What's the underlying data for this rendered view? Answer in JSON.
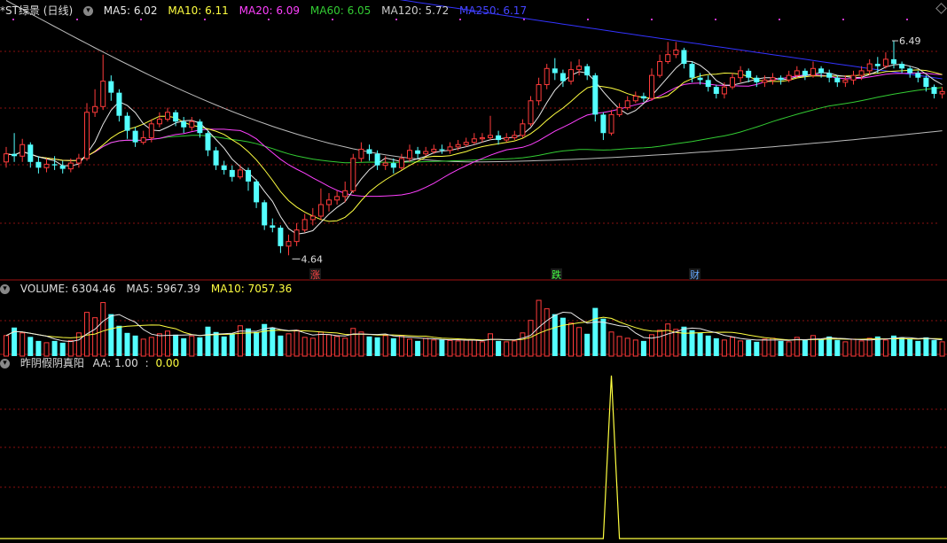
{
  "colors": {
    "up": "#ff3b3b",
    "down": "#54ffff",
    "ma5": "#e8e8e8",
    "ma10": "#ffff40",
    "ma20": "#ff40ff",
    "ma60": "#33cc33",
    "ma120": "#bbbbbb",
    "ma250": "#3333ff",
    "aa": "#ffff40",
    "grid": "#8a1010"
  },
  "icons": [
    "chevron-down-icon",
    "diamond-icon"
  ],
  "price_panel": {
    "title": "*ST绿景 (日线)",
    "ma5": "MA5: 6.02",
    "ma10": "MA10: 6.11",
    "ma20": "MA20: 6.09",
    "ma60": "MA60: 6.05",
    "ma120": "MA120: 5.72",
    "ma250": "MA250: 6.17",
    "high_label": "6.49",
    "low_label": "4.64",
    "markers": [
      "涨",
      "跌",
      "财"
    ]
  },
  "volume_panel": {
    "volume": "VOLUME: 6304.46",
    "ma5": "MA5: 5967.39",
    "ma10": "MA10: 7057.36"
  },
  "indicator_panel": {
    "name": "昨阴假阴真阳",
    "aa": "AA: 1.00",
    "sep": ":",
    "val": "0.00"
  },
  "chart_data": {
    "type": "candlestick",
    "title": "*ST绿景 (日线)",
    "price_extremes": {
      "high": 6.49,
      "low": 4.64
    },
    "ma_latest": {
      "MA5": 6.02,
      "MA10": 6.11,
      "MA20": 6.09,
      "MA60": 6.05,
      "MA120": 5.72,
      "MA250": 6.17
    },
    "candles": [
      [
        5.45,
        5.52,
        5.58,
        5.4
      ],
      [
        5.52,
        5.5,
        5.7,
        5.45
      ],
      [
        5.5,
        5.6,
        5.65,
        5.45
      ],
      [
        5.6,
        5.45,
        5.62,
        5.4
      ],
      [
        5.45,
        5.4,
        5.5,
        5.35
      ],
      [
        5.4,
        5.43,
        5.48,
        5.36
      ],
      [
        5.43,
        5.42,
        5.5,
        5.38
      ],
      [
        5.42,
        5.39,
        5.46,
        5.35
      ],
      [
        5.39,
        5.44,
        5.48,
        5.36
      ],
      [
        5.44,
        5.48,
        5.52,
        5.4
      ],
      [
        5.48,
        5.88,
        5.96,
        5.46
      ],
      [
        5.88,
        5.93,
        6.08,
        5.84
      ],
      [
        5.93,
        6.15,
        6.38,
        5.9
      ],
      [
        6.15,
        6.05,
        6.2,
        5.98
      ],
      [
        6.05,
        5.85,
        6.08,
        5.8
      ],
      [
        5.85,
        5.72,
        5.88,
        5.65
      ],
      [
        5.72,
        5.62,
        5.75,
        5.58
      ],
      [
        5.62,
        5.66,
        5.72,
        5.6
      ],
      [
        5.66,
        5.78,
        5.82,
        5.62
      ],
      [
        5.78,
        5.82,
        5.88,
        5.75
      ],
      [
        5.82,
        5.88,
        5.92,
        5.8
      ],
      [
        5.88,
        5.8,
        5.9,
        5.76
      ],
      [
        5.8,
        5.75,
        5.84,
        5.7
      ],
      [
        5.75,
        5.8,
        5.84,
        5.72
      ],
      [
        5.8,
        5.7,
        5.82,
        5.66
      ],
      [
        5.7,
        5.55,
        5.72,
        5.5
      ],
      [
        5.55,
        5.42,
        5.58,
        5.38
      ],
      [
        5.42,
        5.38,
        5.46,
        5.34
      ],
      [
        5.38,
        5.32,
        5.42,
        5.28
      ],
      [
        5.32,
        5.38,
        5.42,
        5.3
      ],
      [
        5.38,
        5.28,
        5.4,
        5.2
      ],
      [
        5.28,
        5.1,
        5.3,
        5.05
      ],
      [
        5.1,
        4.9,
        5.12,
        4.86
      ],
      [
        4.9,
        4.88,
        4.96,
        4.84
      ],
      [
        4.88,
        4.72,
        4.9,
        4.66
      ],
      [
        4.72,
        4.76,
        4.82,
        4.64
      ],
      [
        4.76,
        4.86,
        4.92,
        4.72
      ],
      [
        4.86,
        4.95,
        5.0,
        4.84
      ],
      [
        4.95,
        4.98,
        5.05,
        4.9
      ],
      [
        4.98,
        5.08,
        5.22,
        4.95
      ],
      [
        5.08,
        5.12,
        5.18,
        5.02
      ],
      [
        5.12,
        5.15,
        5.2,
        5.08
      ],
      [
        5.15,
        5.2,
        5.28,
        5.1
      ],
      [
        5.2,
        5.48,
        5.52,
        5.18
      ],
      [
        5.48,
        5.56,
        5.62,
        5.45
      ],
      [
        5.56,
        5.52,
        5.6,
        5.46
      ],
      [
        5.52,
        5.42,
        5.55,
        5.38
      ],
      [
        5.42,
        5.44,
        5.5,
        5.38
      ],
      [
        5.44,
        5.4,
        5.48,
        5.35
      ],
      [
        5.4,
        5.48,
        5.52,
        5.38
      ],
      [
        5.48,
        5.55,
        5.6,
        5.45
      ],
      [
        5.55,
        5.52,
        5.58,
        5.48
      ],
      [
        5.52,
        5.54,
        5.58,
        5.5
      ],
      [
        5.54,
        5.56,
        5.6,
        5.52
      ],
      [
        5.56,
        5.55,
        5.6,
        5.52
      ],
      [
        5.55,
        5.58,
        5.62,
        5.52
      ],
      [
        5.58,
        5.6,
        5.64,
        5.55
      ],
      [
        5.6,
        5.62,
        5.66,
        5.58
      ],
      [
        5.62,
        5.65,
        5.7,
        5.6
      ],
      [
        5.65,
        5.66,
        5.7,
        5.62
      ],
      [
        5.66,
        5.68,
        5.85,
        5.64
      ],
      [
        5.68,
        5.64,
        5.72,
        5.6
      ],
      [
        5.64,
        5.66,
        5.7,
        5.62
      ],
      [
        5.66,
        5.68,
        5.72,
        5.64
      ],
      [
        5.68,
        5.78,
        5.82,
        5.66
      ],
      [
        5.78,
        5.98,
        6.02,
        5.76
      ],
      [
        5.98,
        6.12,
        6.18,
        5.94
      ],
      [
        6.12,
        6.26,
        6.3,
        6.08
      ],
      [
        6.26,
        6.22,
        6.35,
        6.16
      ],
      [
        6.22,
        6.15,
        6.25,
        6.1
      ],
      [
        6.15,
        6.25,
        6.32,
        6.12
      ],
      [
        6.25,
        6.28,
        6.34,
        6.2
      ],
      [
        6.28,
        6.2,
        6.3,
        6.16
      ],
      [
        6.2,
        5.86,
        6.22,
        5.8
      ],
      [
        5.86,
        5.7,
        5.88,
        5.64
      ],
      [
        5.7,
        5.86,
        5.9,
        5.68
      ],
      [
        5.86,
        5.92,
        5.96,
        5.84
      ],
      [
        5.92,
        5.98,
        6.02,
        5.9
      ],
      [
        5.98,
        6.02,
        6.06,
        5.96
      ],
      [
        6.02,
        6.0,
        6.05,
        5.97
      ],
      [
        6.0,
        6.2,
        6.26,
        5.98
      ],
      [
        6.2,
        6.32,
        6.38,
        6.18
      ],
      [
        6.32,
        6.38,
        6.49,
        6.3
      ],
      [
        6.38,
        6.42,
        6.49,
        6.35
      ],
      [
        6.42,
        6.3,
        6.44,
        6.26
      ],
      [
        6.3,
        6.18,
        6.32,
        6.14
      ],
      [
        6.18,
        6.16,
        6.22,
        6.12
      ],
      [
        6.16,
        6.1,
        6.2,
        6.06
      ],
      [
        6.1,
        6.04,
        6.12,
        6.0
      ],
      [
        6.04,
        6.1,
        6.14,
        6.0
      ],
      [
        6.1,
        6.18,
        6.22,
        6.08
      ],
      [
        6.18,
        6.24,
        6.28,
        6.14
      ],
      [
        6.24,
        6.18,
        6.26,
        6.14
      ],
      [
        6.18,
        6.14,
        6.2,
        6.1
      ],
      [
        6.14,
        6.16,
        6.2,
        6.1
      ],
      [
        6.16,
        6.18,
        6.22,
        6.12
      ],
      [
        6.18,
        6.16,
        6.2,
        6.12
      ],
      [
        6.16,
        6.2,
        6.24,
        6.14
      ],
      [
        6.2,
        6.24,
        6.28,
        6.18
      ],
      [
        6.24,
        6.2,
        6.26,
        6.16
      ],
      [
        6.2,
        6.26,
        6.32,
        6.18
      ],
      [
        6.26,
        6.22,
        6.28,
        6.18
      ],
      [
        6.22,
        6.18,
        6.25,
        6.14
      ],
      [
        6.18,
        6.14,
        6.2,
        6.1
      ],
      [
        6.14,
        6.16,
        6.2,
        6.1
      ],
      [
        6.16,
        6.2,
        6.24,
        6.12
      ],
      [
        6.2,
        6.24,
        6.28,
        6.16
      ],
      [
        6.24,
        6.3,
        6.34,
        6.2
      ],
      [
        6.3,
        6.28,
        6.36,
        6.22
      ],
      [
        6.28,
        6.34,
        6.4,
        6.26
      ],
      [
        6.34,
        6.3,
        6.5,
        6.26
      ],
      [
        6.3,
        6.26,
        6.32,
        6.22
      ],
      [
        6.26,
        6.22,
        6.28,
        6.18
      ],
      [
        6.22,
        6.18,
        6.24,
        6.14
      ],
      [
        6.18,
        6.1,
        6.2,
        6.06
      ],
      [
        6.1,
        6.04,
        6.12,
        6.0
      ],
      [
        6.04,
        6.06,
        6.1,
        6.0
      ]
    ],
    "volume": [
      4600,
      6400,
      5200,
      4300,
      3400,
      3000,
      3400,
      3000,
      3500,
      5200,
      9800,
      8600,
      12000,
      9400,
      6800,
      5200,
      4600,
      3800,
      4200,
      5000,
      5600,
      4800,
      4000,
      4500,
      4200,
      6600,
      5400,
      4400,
      5000,
      6800,
      6200,
      5400,
      7200,
      6400,
      4600,
      5000,
      5800,
      4200,
      4000,
      5400,
      4800,
      4400,
      4000,
      6200,
      5400,
      4400,
      4200,
      4600,
      4000,
      4600,
      3800,
      3400,
      4000,
      3600,
      3800,
      3500,
      3400,
      3600,
      3600,
      3200,
      5000,
      3400,
      3200,
      3400,
      5200,
      8000,
      12500,
      10600,
      9400,
      8600,
      7400,
      6400,
      5000,
      10800,
      8400,
      5400,
      4400,
      4000,
      3600,
      3400,
      4800,
      5800,
      7200,
      6000,
      6600,
      5800,
      5200,
      4600,
      4000,
      3600,
      4200,
      3400,
      3600,
      3200,
      3800,
      4000,
      3400,
      3200,
      4200,
      3600,
      4600,
      3800,
      4400,
      3600,
      3200,
      3800,
      3400,
      4000,
      4400,
      3600,
      4600,
      4200,
      3800,
      3400,
      4200,
      3600,
      3200
    ],
    "indicator": {
      "name": "昨阴假阴真阳",
      "signal_index": 75,
      "signal_value": 1.0,
      "baseline": 0.0
    },
    "series_names": [
      "MA5",
      "MA10",
      "MA20",
      "MA60",
      "MA120",
      "MA250"
    ]
  }
}
